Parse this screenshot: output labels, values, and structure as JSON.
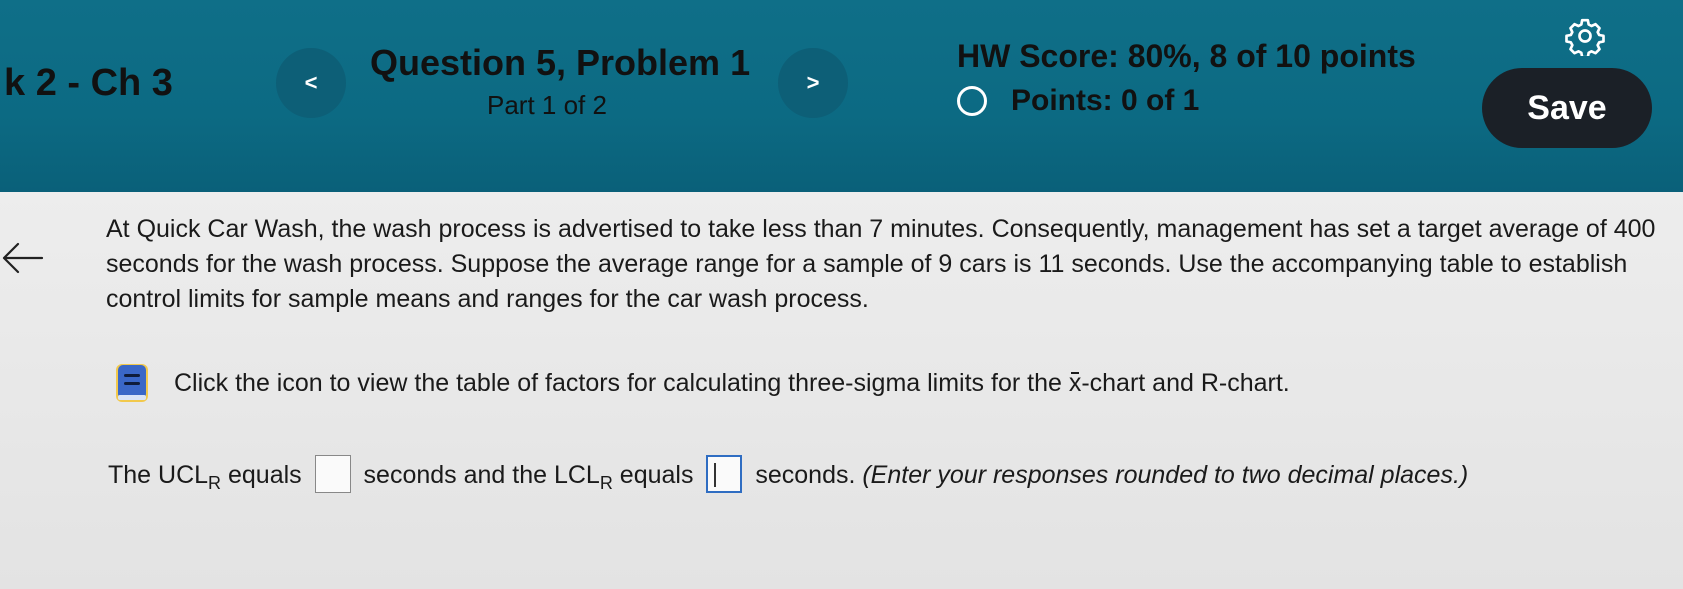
{
  "header": {
    "chapter_label": "k 2 - Ch 3",
    "question_title": "Question 5, Problem 1",
    "question_part": "Part 1 of 2",
    "prev_icon": "chevron-left-icon",
    "next_icon": "chevron-right-icon",
    "prev_glyph": "<",
    "next_glyph": ">",
    "hw_score": "HW Score: 80%, 8 of 10 points",
    "points": "Points: 0 of 1",
    "settings_icon": "gear-icon",
    "save_label": "Save",
    "background_color": "#0c6a83",
    "save_color": "#1b2027"
  },
  "content": {
    "back_icon": "arrow-left-icon",
    "problem_text": "At Quick Car Wash, the wash process is advertised to take less than 7 minutes. Consequently, management has set a target average of 400 seconds for the wash process. Suppose the average range for a sample of 9 cars is 11 seconds. Use the accompanying table to establish control limits for sample means and ranges for the car wash process.",
    "table_link": {
      "icon": "book-icon",
      "text_before": "Click the icon to view the table of factors for calculating three-sigma limits for the ",
      "xbar_glyph": "x",
      "text_after": "-chart and R-chart."
    },
    "answer": {
      "part1": "The UCL",
      "sub1": "R",
      "part2": " equals ",
      "part3": " seconds and the LCL",
      "sub2": "R",
      "part4": " equals ",
      "part5": " seconds. ",
      "instruction": "(Enter your responses rounded to two decimal places.)",
      "ucl_value": "",
      "lcl_value": ""
    }
  }
}
